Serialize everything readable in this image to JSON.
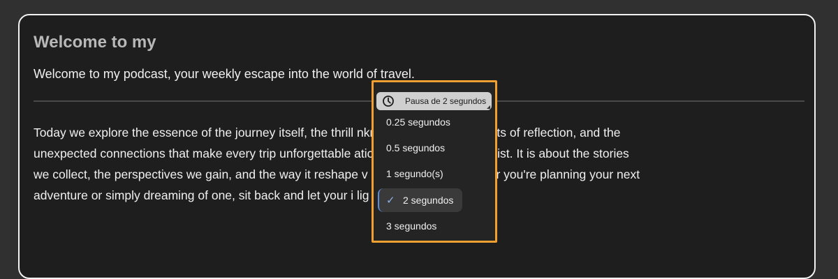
{
  "document": {
    "title": "Welcome to my",
    "intro": "Welcome to my podcast, your weekly escape into the world of travel.",
    "body_lines": [
      "Today we explore the essence of the journey itself, the thrill nknown, the quiet moments of reflection, and the",
      "unexpected connections that make every trip unforgettable aticking destinations off a list. It is about the stories",
      "we collect, the perspectives we gain, and the way it reshape v and ourselves. Whether you're planning your next",
      "adventure or simply dreaming of one, sit back and let your i lig"
    ]
  },
  "pause_menu": {
    "trigger_label": "Pausa de 2 segundos",
    "trigger_icon": "clock-icon",
    "options": [
      {
        "label": "0.25 segundos",
        "selected": false
      },
      {
        "label": "0.5 segundos",
        "selected": false
      },
      {
        "label": "1 segundo(s)",
        "selected": false
      },
      {
        "label": "2 segundos",
        "selected": true
      },
      {
        "label": "3 segundos",
        "selected": false
      }
    ],
    "highlight_color": "#f0a030",
    "check_color": "#5b8dd8"
  }
}
